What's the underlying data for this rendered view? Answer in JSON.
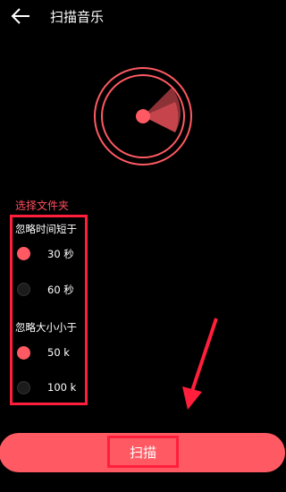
{
  "header": {
    "title": "扫描音乐",
    "back_icon": "back-arrow-icon"
  },
  "radar": {
    "icon": "radar-scan-icon",
    "color": "#ff5a63"
  },
  "folder": {
    "label": "选择文件夹"
  },
  "duration_filter": {
    "title": "忽略时间短于",
    "options": [
      {
        "label": "30 秒",
        "selected": true
      },
      {
        "label": "60 秒",
        "selected": false
      }
    ]
  },
  "size_filter": {
    "title": "忽略大小小于",
    "options": [
      {
        "label": "50 k",
        "selected": true
      },
      {
        "label": "100 k",
        "selected": false
      }
    ]
  },
  "scan_button": {
    "label": "扫描"
  },
  "colors": {
    "accent": "#ff5a63",
    "highlight": "#ff1f3c",
    "background": "#000000"
  }
}
